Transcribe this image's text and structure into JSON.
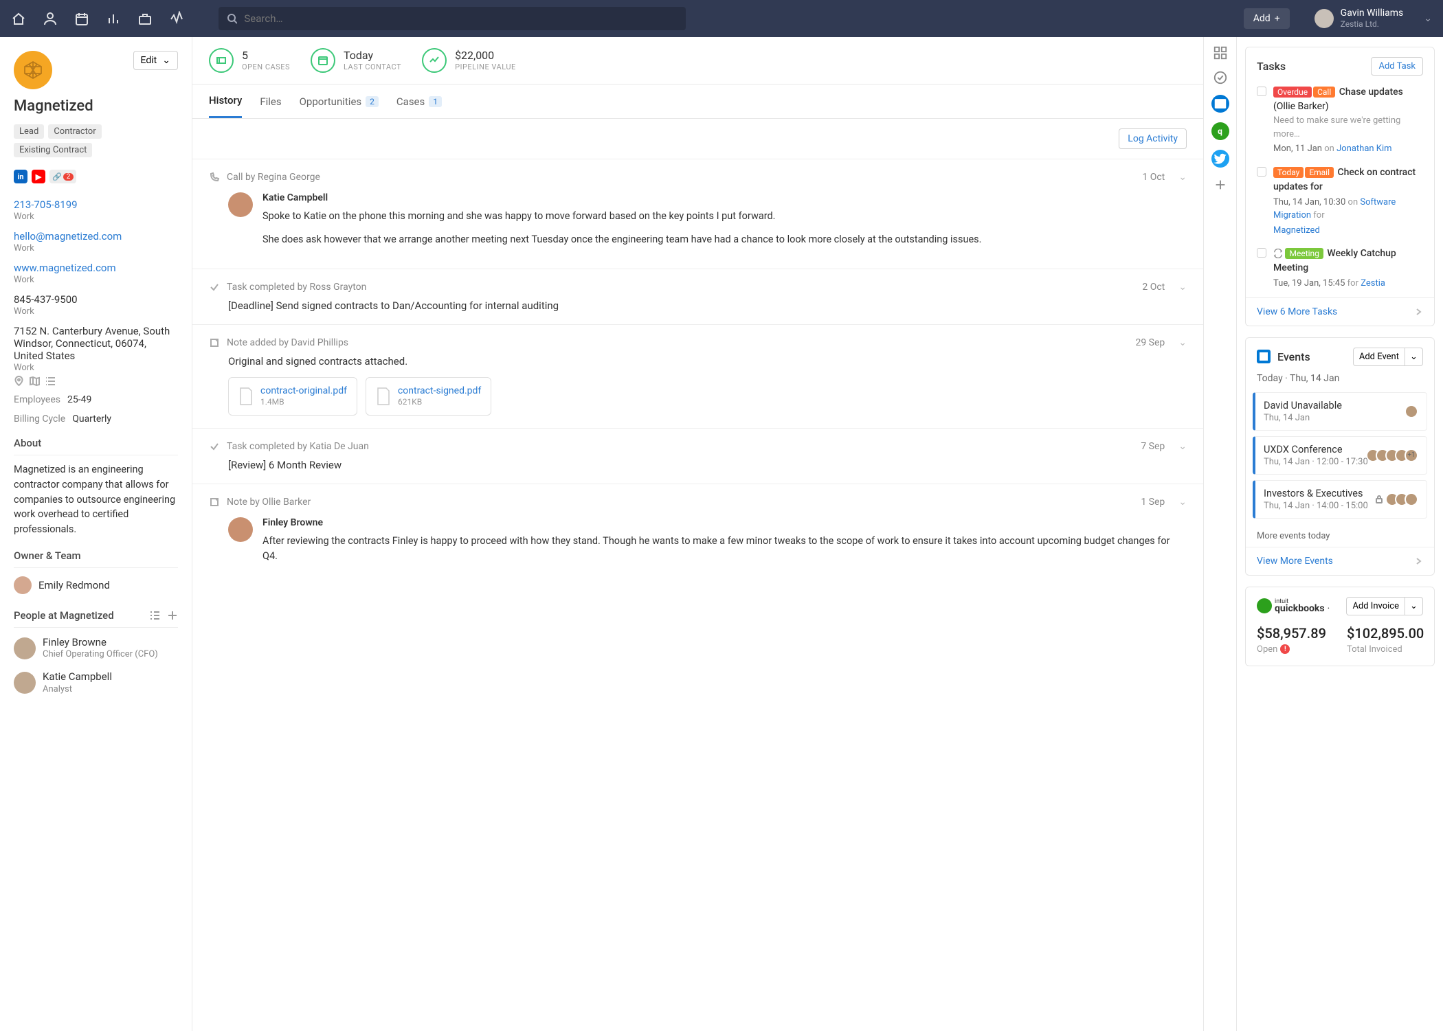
{
  "topbar": {
    "search_placeholder": "Search…",
    "add_label": "Add",
    "user_name": "Gavin Williams",
    "user_org": "Zestia Ltd."
  },
  "org": {
    "name": "Magnetized",
    "edit_label": "Edit",
    "tags": [
      "Lead",
      "Contractor",
      "Existing Contract"
    ],
    "link_count": "2",
    "contacts": [
      {
        "value": "213-705-8199",
        "label": "Work",
        "link": true
      },
      {
        "value": "hello@magnetized.com",
        "label": "Work",
        "link": true
      },
      {
        "value": "www.magnetized.com",
        "label": "Work",
        "link": true
      },
      {
        "value": "845-437-9500",
        "label": "Work",
        "link": false
      },
      {
        "value": "7152 N. Canterbury Avenue, South Windsor, Connecticut, 06074, United States",
        "label": "Work",
        "link": false
      }
    ],
    "employees_label": "Employees",
    "employees": "25-49",
    "billing_label": "Billing Cycle",
    "billing": "Quarterly",
    "about_title": "About",
    "about": "Magnetized is an engineering contractor company that allows for companies to outsource engineering work overhead to certified professionals.",
    "owner_title": "Owner & Team",
    "owner": "Emily Redmond",
    "people_title": "People at Magnetized",
    "people": [
      {
        "name": "Finley Browne",
        "role": "Chief Operating Officer (CFO)"
      },
      {
        "name": "Katie Campbell",
        "role": "Analyst"
      }
    ]
  },
  "stats": [
    {
      "val": "5",
      "lbl": "Open Cases"
    },
    {
      "val": "Today",
      "lbl": "Last Contact"
    },
    {
      "val": "$22,000",
      "lbl": "Pipeline Value"
    }
  ],
  "tabs": [
    {
      "label": "History",
      "active": true
    },
    {
      "label": "Files"
    },
    {
      "label": "Opportunities",
      "count": "2"
    },
    {
      "label": "Cases",
      "count": "1"
    }
  ],
  "log_label": "Log Activity",
  "feed": [
    {
      "type": "call",
      "header": "Call by Regina George",
      "date": "1 Oct",
      "person": "Katie Campbell",
      "paragraphs": [
        "Spoke to Katie on the phone this morning and she was happy to move forward based on the key points I put forward.",
        "She does ask however that we arrange another meeting next Tuesday once the engineering team have had a chance to look more closely at the outstanding issues."
      ]
    },
    {
      "type": "task",
      "header": "Task completed by Ross Grayton",
      "date": "2 Oct",
      "task": "[Deadline] Send signed contracts to Dan/Accounting for internal auditing"
    },
    {
      "type": "note",
      "header": "Note added by David Phillips",
      "date": "29 Sep",
      "caption": "Original and signed contracts attached.",
      "files": [
        {
          "name": "contract-original.pdf",
          "size": "1.4MB"
        },
        {
          "name": "contract-signed.pdf",
          "size": "621KB"
        }
      ]
    },
    {
      "type": "task",
      "header": "Task completed by Katia De Juan",
      "date": "7 Sep",
      "task": "[Review] 6 Month Review"
    },
    {
      "type": "note2",
      "header": "Note by Ollie Barker",
      "date": "1 Sep",
      "person": "Finley Browne",
      "paragraphs": [
        "After reviewing the contracts Finley is happy to proceed with how they stand. Though he wants to make a few minor tweaks to the scope of work to ensure it takes into account upcoming budget changes for Q4."
      ]
    }
  ],
  "tasks_card": {
    "title": "Tasks",
    "add": "Add Task",
    "footer": "View 6 More Tasks",
    "items": [
      {
        "badges": [
          "Overdue",
          "Call"
        ],
        "title": "Chase updates",
        "paren": "(Ollie Barker)",
        "sub": "Need to make sure we're getting more…",
        "date": "Mon, 11 Jan",
        "on": "on",
        "link": "Jonathan Kim"
      },
      {
        "badges": [
          "Today",
          "Email"
        ],
        "title": "Check on contract updates for",
        "date": "Thu, 14 Jan, 10:30",
        "on": "on",
        "link": "Software Migration",
        "for": "for",
        "link2": "Magnetized"
      },
      {
        "badges": [
          "Meeting"
        ],
        "title": "Weekly Catchup Meeting",
        "repeat": true,
        "date": "Tue, 19 Jan, 15:45",
        "on": "for",
        "link": "Zestia"
      }
    ]
  },
  "events_card": {
    "title": "Events",
    "add": "Add Event",
    "date": "Today · Thu, 14 Jan",
    "items": [
      {
        "title": "David Unavailable",
        "time": "Thu, 14 Jan",
        "people": 1
      },
      {
        "title": "UXDX Conference",
        "time": "Thu, 14 Jan · 12:00 - 17:30",
        "people": 4,
        "more": "+1"
      },
      {
        "title": "Investors & Executives",
        "time": "Thu, 14 Jan · 14:00 - 15:00",
        "people": 3,
        "locked": true
      }
    ],
    "more": "More events today",
    "footer": "View More Events"
  },
  "qb": {
    "add": "Add Invoice",
    "brand_small": "intuit",
    "brand": "quickbooks",
    "open_val": "$58,957.89",
    "open_lbl": "Open",
    "total_val": "$102,895.00",
    "total_lbl": "Total Invoiced"
  }
}
